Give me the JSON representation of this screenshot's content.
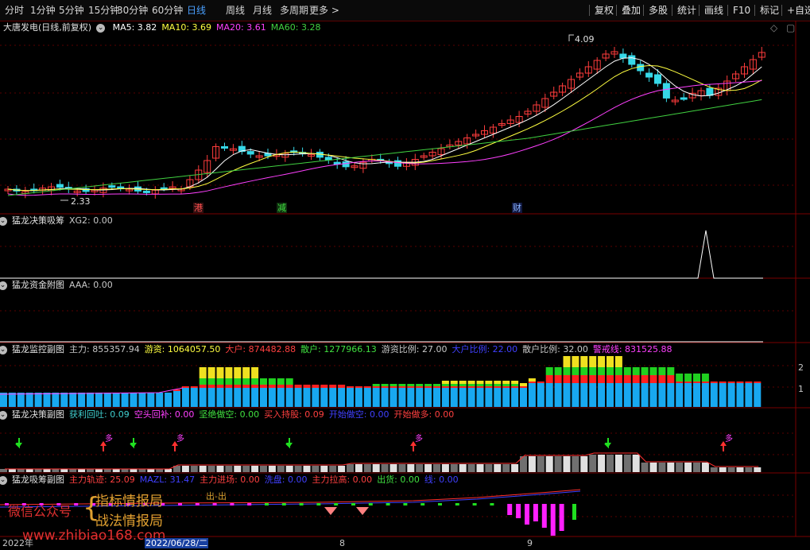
{
  "toolbar": {
    "timeframes": [
      "分时",
      "1分钟",
      "5分钟",
      "15分钟",
      "30分钟",
      "60分钟",
      "日线",
      "周线",
      "月线",
      "多周期",
      "更多 >"
    ],
    "active": "日线",
    "buttons": [
      "复权",
      "叠加",
      "多股",
      "统计",
      "画线",
      "F10",
      "标记",
      "+自选"
    ]
  },
  "main": {
    "title": "大唐发电(日线,前复权)",
    "ma": [
      {
        "label": "MA5: 3.82",
        "color": "#ffffff"
      },
      {
        "label": "MA10: 3.69",
        "color": "#ffff40"
      },
      {
        "label": "MA20: 3.61",
        "color": "#ff40ff"
      },
      {
        "label": "MA60: 3.28",
        "color": "#40d040"
      }
    ],
    "high_label": "4.09",
    "low_label": "2.33",
    "markers": [
      {
        "text": "港",
        "color": "#ff5050"
      },
      {
        "text": "减",
        "color": "#40e040"
      },
      {
        "text": "财",
        "color": "#8ab4ff"
      }
    ]
  },
  "p1": {
    "title": "猛龙决策吸筹",
    "items": [
      {
        "label": "XG2: 0.00",
        "color": "#c8c8c8"
      }
    ]
  },
  "p2": {
    "title": "猛龙资金附图",
    "items": [
      {
        "label": "AAA: 0.00",
        "color": "#c8c8c8"
      }
    ]
  },
  "p3": {
    "title": "猛龙监控副图",
    "items": [
      {
        "label": "主力: 855357.94",
        "color": "#c8c8c8"
      },
      {
        "label": "游资: 1064057.50",
        "color": "#ffff40"
      },
      {
        "label": "大户: 874482.88",
        "color": "#ff4040"
      },
      {
        "label": "散户: 1277966.13",
        "color": "#40e040"
      },
      {
        "label": "游资比例: 27.00",
        "color": "#c8c8c8"
      },
      {
        "label": "大户比例: 22.00",
        "color": "#4040ff"
      },
      {
        "label": "散户比例: 32.00",
        "color": "#c8c8c8"
      },
      {
        "label": "警戒线: 831525.88",
        "color": "#ff40ff"
      }
    ]
  },
  "p4": {
    "title": "猛龙决策副图",
    "items": [
      {
        "label": "获利回吐: 0.09",
        "color": "#40d0d0"
      },
      {
        "label": "空头回补: 0.00",
        "color": "#ff40ff"
      },
      {
        "label": "坚绝做空: 0.00",
        "color": "#40e040"
      },
      {
        "label": "买入持股: 0.09",
        "color": "#ff4040"
      },
      {
        "label": "开始做空: 0.00",
        "color": "#4040ff"
      },
      {
        "label": "开始做多: 0.00",
        "color": "#ff4040"
      }
    ]
  },
  "p5": {
    "title": "猛龙吸筹副图",
    "items": [
      {
        "label": "主力轨迹: 25.09",
        "color": "#ff4040"
      },
      {
        "label": "MAZL: 31.47",
        "color": "#4040ff"
      },
      {
        "label": "主力进场: 0.00",
        "color": "#ff4040"
      },
      {
        "label": "洗盘: 0.00",
        "color": "#4040ff"
      },
      {
        "label": "主力拉高: 0.00",
        "color": "#ff4040"
      },
      {
        "label": "出货: 0.00",
        "color": "#40e040"
      },
      {
        "label": "线: 0.00",
        "color": "#4040ff"
      }
    ]
  },
  "p5_label": "出-出",
  "watermark": {
    "wechat": "微信公众号",
    "brand1": "指标情报局",
    "brand2": "战法情报局",
    "url": "www.zhibiao168.com"
  },
  "xaxis": {
    "year": "2022年",
    "cursor_date": "2022/06/28/二",
    "m8": "8",
    "m9": "9"
  },
  "rightaxis": {
    "p3_a": "2",
    "p3_b": "1"
  }
}
